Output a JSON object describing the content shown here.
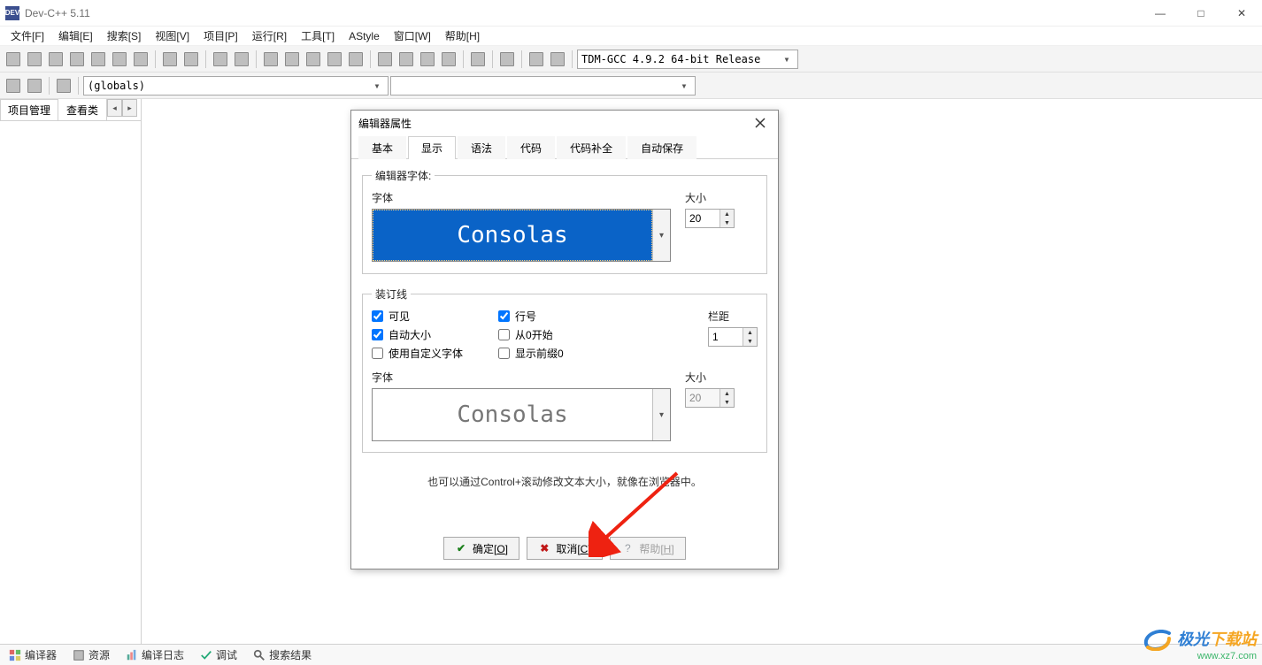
{
  "window": {
    "title": "Dev-C++ 5.11",
    "minimize": "—",
    "maximize": "□",
    "close": "✕"
  },
  "menu": {
    "items": [
      "文件[F]",
      "编辑[E]",
      "搜索[S]",
      "视图[V]",
      "项目[P]",
      "运行[R]",
      "工具[T]",
      "AStyle",
      "窗口[W]",
      "帮助[H]"
    ]
  },
  "toolbar": {
    "compiler_combo": "TDM-GCC 4.9.2 64-bit Release",
    "scope_combo": "(globals)"
  },
  "sidepanel": {
    "tabs": [
      "项目管理",
      "查看类"
    ],
    "nav_left": "◂",
    "nav_right": "▸"
  },
  "bottom": {
    "items": [
      "编译器",
      "资源",
      "编译日志",
      "调试",
      "搜索结果"
    ]
  },
  "dialog": {
    "title": "编辑器属性",
    "tabs": [
      "基本",
      "显示",
      "语法",
      "代码",
      "代码补全",
      "自动保存"
    ],
    "active_tab": 1,
    "font_group": {
      "legend": "编辑器字体:",
      "font_label": "字体",
      "font_value": "Consolas",
      "size_label": "大小",
      "size_value": "20"
    },
    "gutter_group": {
      "legend": "装订线",
      "checks": [
        {
          "label": "可见",
          "checked": true
        },
        {
          "label": "自动大小",
          "checked": true
        },
        {
          "label": "使用自定义字体",
          "checked": false
        },
        {
          "label": "行号",
          "checked": true
        },
        {
          "label": "从0开始",
          "checked": false
        },
        {
          "label": "显示前缀0",
          "checked": false
        }
      ],
      "margin_label": "栏距",
      "margin_value": "1",
      "font_label": "字体",
      "font_value": "Consolas",
      "size_label": "大小",
      "size_value": "20"
    },
    "hint": "也可以通过Control+滚动修改文本大小，就像在浏览器中。",
    "buttons": {
      "ok_pre": "确定[",
      "ok_key": "O",
      "ok_post": "]",
      "cancel_pre": "取消[",
      "cancel_key": "C",
      "cancel_post": "]",
      "help_pre": "帮助[",
      "help_key": "H",
      "help_post": "]"
    }
  },
  "watermark": {
    "brand_a": "极光",
    "brand_b": "下载站",
    "url": "www.xz7.com"
  }
}
